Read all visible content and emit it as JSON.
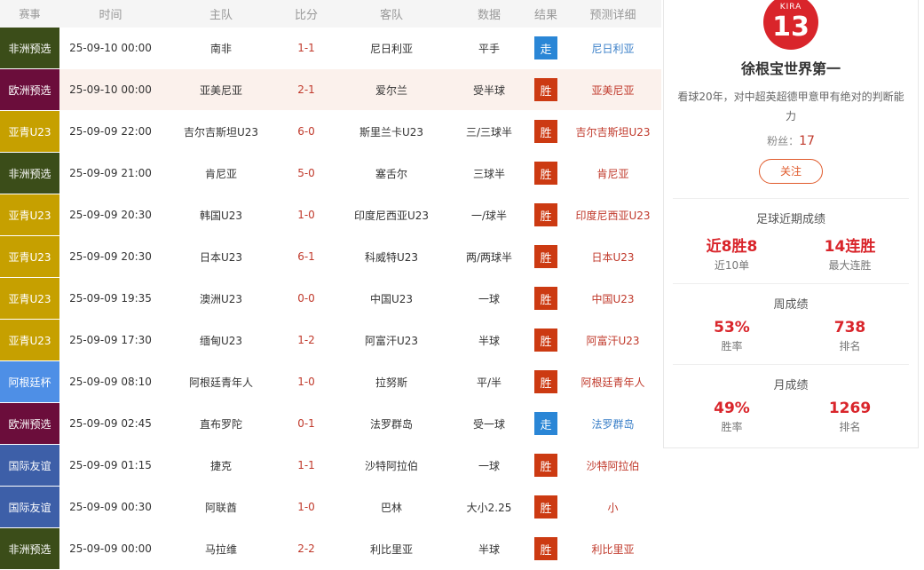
{
  "headers": {
    "league": "赛事",
    "time": "时间",
    "home": "主队",
    "score": "比分",
    "away": "客队",
    "data": "数据",
    "result": "结果",
    "prediction": "预测详细"
  },
  "colors": {
    "africa": "#3b4d19",
    "europe": "#6b0d3b",
    "asia_u23": "#c6a000",
    "argentina": "#4e8fe6",
    "friendly": "#3d5fa8",
    "win": "#cc3a12",
    "draw": "#2a86d6",
    "pred_win": "#c0392b",
    "pred_draw": "#3a7fc8"
  },
  "matches": [
    {
      "league": "非洲预选",
      "league_color": "#3b4d19",
      "time": "25-09-10 00:00",
      "home": "南非",
      "score": "1-1",
      "away": "尼日利亚",
      "data": "平手",
      "result": "走",
      "result_color": "#2a86d6",
      "prediction": "尼日利亚",
      "pred_color": "#3a7fc8"
    },
    {
      "league": "欧洲预选",
      "league_color": "#6b0d3b",
      "time": "25-09-10 00:00",
      "home": "亚美尼亚",
      "score": "2-1",
      "away": "爱尔兰",
      "data": "受半球",
      "result": "胜",
      "result_color": "#cc3a12",
      "prediction": "亚美尼亚",
      "pred_color": "#c0392b"
    },
    {
      "league": "亚青U23",
      "league_color": "#c6a000",
      "time": "25-09-09 22:00",
      "home": "吉尔吉斯坦U23",
      "score": "6-0",
      "away": "斯里兰卡U23",
      "data": "三/三球半",
      "result": "胜",
      "result_color": "#cc3a12",
      "prediction": "吉尔吉斯坦U23",
      "pred_color": "#c0392b"
    },
    {
      "league": "非洲预选",
      "league_color": "#3b4d19",
      "time": "25-09-09 21:00",
      "home": "肯尼亚",
      "score": "5-0",
      "away": "塞舌尔",
      "data": "三球半",
      "result": "胜",
      "result_color": "#cc3a12",
      "prediction": "肯尼亚",
      "pred_color": "#c0392b"
    },
    {
      "league": "亚青U23",
      "league_color": "#c6a000",
      "time": "25-09-09 20:30",
      "home": "韩国U23",
      "score": "1-0",
      "away": "印度尼西亚U23",
      "data": "一/球半",
      "result": "胜",
      "result_color": "#cc3a12",
      "prediction": "印度尼西亚U23",
      "pred_color": "#c0392b"
    },
    {
      "league": "亚青U23",
      "league_color": "#c6a000",
      "time": "25-09-09 20:30",
      "home": "日本U23",
      "score": "6-1",
      "away": "科威特U23",
      "data": "两/两球半",
      "result": "胜",
      "result_color": "#cc3a12",
      "prediction": "日本U23",
      "pred_color": "#c0392b"
    },
    {
      "league": "亚青U23",
      "league_color": "#c6a000",
      "time": "25-09-09 19:35",
      "home": "澳洲U23",
      "score": "0-0",
      "away": "中国U23",
      "data": "一球",
      "result": "胜",
      "result_color": "#cc3a12",
      "prediction": "中国U23",
      "pred_color": "#c0392b"
    },
    {
      "league": "亚青U23",
      "league_color": "#c6a000",
      "time": "25-09-09 17:30",
      "home": "缅甸U23",
      "score": "1-2",
      "away": "阿富汗U23",
      "data": "半球",
      "result": "胜",
      "result_color": "#cc3a12",
      "prediction": "阿富汗U23",
      "pred_color": "#c0392b"
    },
    {
      "league": "阿根廷杯",
      "league_color": "#4e8fe6",
      "time": "25-09-09 08:10",
      "home": "阿根廷青年人",
      "score": "1-0",
      "away": "拉努斯",
      "data": "平/半",
      "result": "胜",
      "result_color": "#cc3a12",
      "prediction": "阿根廷青年人",
      "pred_color": "#c0392b"
    },
    {
      "league": "欧洲预选",
      "league_color": "#6b0d3b",
      "time": "25-09-09 02:45",
      "home": "直布罗陀",
      "score": "0-1",
      "away": "法罗群岛",
      "data": "受一球",
      "result": "走",
      "result_color": "#2a86d6",
      "prediction": "法罗群岛",
      "pred_color": "#3a7fc8"
    },
    {
      "league": "国际友谊",
      "league_color": "#3d5fa8",
      "time": "25-09-09 01:15",
      "home": "捷克",
      "score": "1-1",
      "away": "沙特阿拉伯",
      "data": "一球",
      "result": "胜",
      "result_color": "#cc3a12",
      "prediction": "沙特阿拉伯",
      "pred_color": "#c0392b"
    },
    {
      "league": "国际友谊",
      "league_color": "#3d5fa8",
      "time": "25-09-09 00:30",
      "home": "阿联酋",
      "score": "1-0",
      "away": "巴林",
      "data": "大小2.25",
      "result": "胜",
      "result_color": "#cc3a12",
      "prediction": "小",
      "pred_color": "#c0392b"
    },
    {
      "league": "非洲预选",
      "league_color": "#3b4d19",
      "time": "25-09-09 00:00",
      "home": "马拉维",
      "score": "2-2",
      "away": "利比里亚",
      "data": "半球",
      "result": "胜",
      "result_color": "#cc3a12",
      "prediction": "利比里亚",
      "pred_color": "#c0392b"
    }
  ],
  "profile": {
    "logo_text": "KIRA",
    "logo_number": "13",
    "name": "徐根宝世界第一",
    "description": "看球20年，对中超英超德甲意甲有绝对的判断能力",
    "fans_label": "粉丝：",
    "fans_count": "17",
    "follow_label": "关注"
  },
  "recent": {
    "title": "足球近期成绩",
    "stat1_value": "近8胜8",
    "stat1_label": "近10单",
    "stat2_value": "14连胜",
    "stat2_label": "最大连胜"
  },
  "weekly": {
    "title": "周成绩",
    "stat1_value": "53%",
    "stat1_label": "胜率",
    "stat2_value": "738",
    "stat2_label": "排名"
  },
  "monthly": {
    "title": "月成绩",
    "stat1_value": "49%",
    "stat1_label": "胜率",
    "stat2_value": "1269",
    "stat2_label": "排名"
  }
}
